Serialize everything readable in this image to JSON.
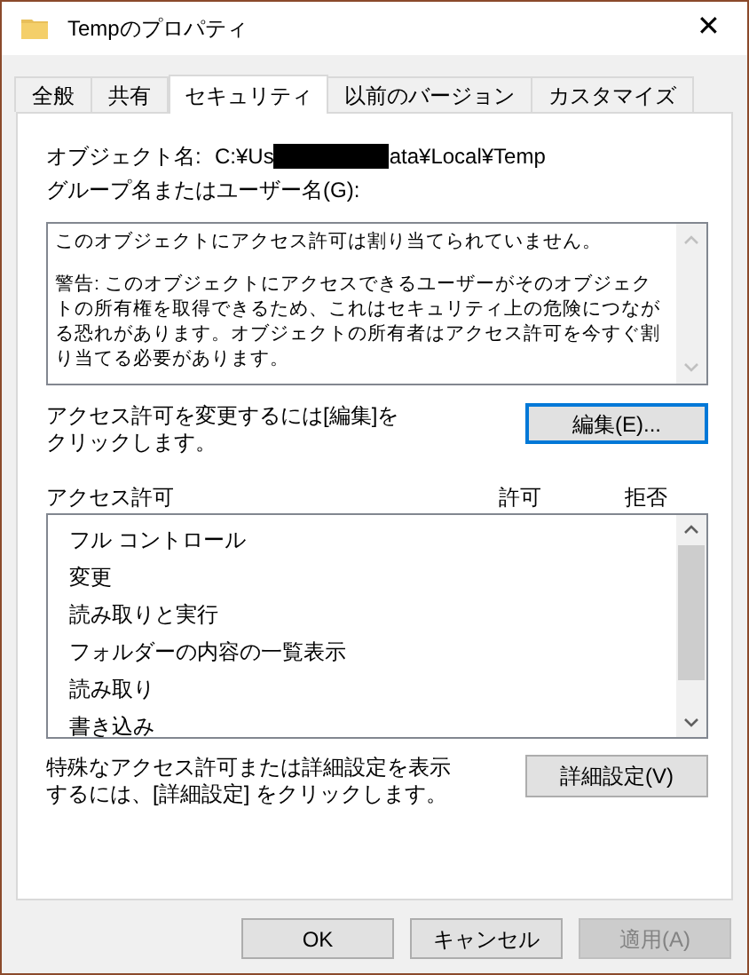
{
  "window": {
    "title": "Tempのプロパティ",
    "close": "✕"
  },
  "tabs": [
    {
      "label": "全般",
      "selected": false
    },
    {
      "label": "共有",
      "selected": false
    },
    {
      "label": "セキュリティ",
      "selected": true
    },
    {
      "label": "以前のバージョン",
      "selected": false
    },
    {
      "label": "カスタマイズ",
      "selected": false
    }
  ],
  "object_name": {
    "label": "オブジェクト名:",
    "parts": [
      {
        "kind": "text",
        "text": "C:¥Us"
      },
      {
        "kind": "redaction"
      },
      {
        "kind": "text",
        "text": "ata¥Local¥Temp"
      }
    ]
  },
  "group_label": "グループ名またはユーザー名(G):",
  "message_box": {
    "paragraphs": [
      "このオブジェクトにアクセス許可は割り当てられていません。",
      "警告: このオブジェクトにアクセスできるユーザーがそのオブジェクトの所有権を取得できるため、これはセキュリティ上の危険につながる恐れがあります。オブジェクトの所有者はアクセス許可を今すぐ割り当てる必要があります。"
    ]
  },
  "edit_hint": "アクセス許可を変更するには[編集]をクリックします。",
  "edit_button": {
    "label": "編集(E)...",
    "focused": true
  },
  "permissions": {
    "columns": [
      "アクセス許可",
      "許可",
      "拒否"
    ],
    "rows": [
      "フル コントロール",
      "変更",
      "読み取りと実行",
      "フォルダーの内容の一覧表示",
      "読み取り",
      "書き込み"
    ]
  },
  "advanced_hint": "特殊なアクセス許可または詳細設定を表示するには、[詳細設定] をクリックします。",
  "advanced_button": {
    "label": "詳細設定(V)"
  },
  "buttons": [
    {
      "label": "OK",
      "disabled": false
    },
    {
      "label": "キャンセル",
      "disabled": false
    },
    {
      "label": "適用(A)",
      "disabled": true
    }
  ]
}
